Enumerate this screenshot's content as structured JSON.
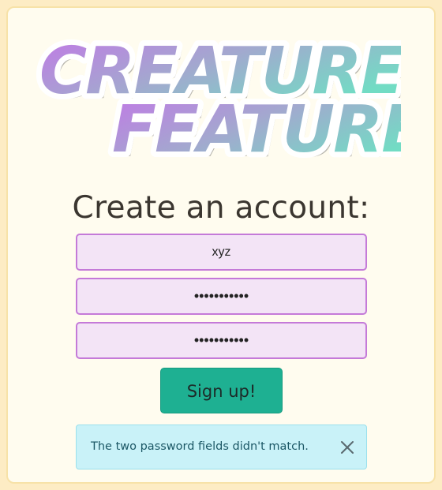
{
  "logo": {
    "line1": "CREATURE",
    "line2": "FEATURE"
  },
  "form": {
    "heading": "Create an account:",
    "fields": [
      {
        "value": "xyz",
        "type": "text"
      },
      {
        "value": "•••••••••••",
        "type": "password"
      },
      {
        "value": "•••••••••••",
        "type": "password"
      }
    ],
    "submit_label": "Sign up!"
  },
  "alert": {
    "message": "The two password fields didn't match.",
    "close_icon": "close-icon"
  },
  "colors": {
    "page_bg": "#fdecc4",
    "card_bg": "#fffcef",
    "field_bg": "#f3e4f6",
    "field_border": "#c47ad8",
    "button_bg": "#1eb092",
    "alert_bg": "#c9f2f8",
    "alert_text": "#1c5866",
    "logo_gradient_start": "#c278e6",
    "logo_gradient_end": "#72dcc4"
  }
}
